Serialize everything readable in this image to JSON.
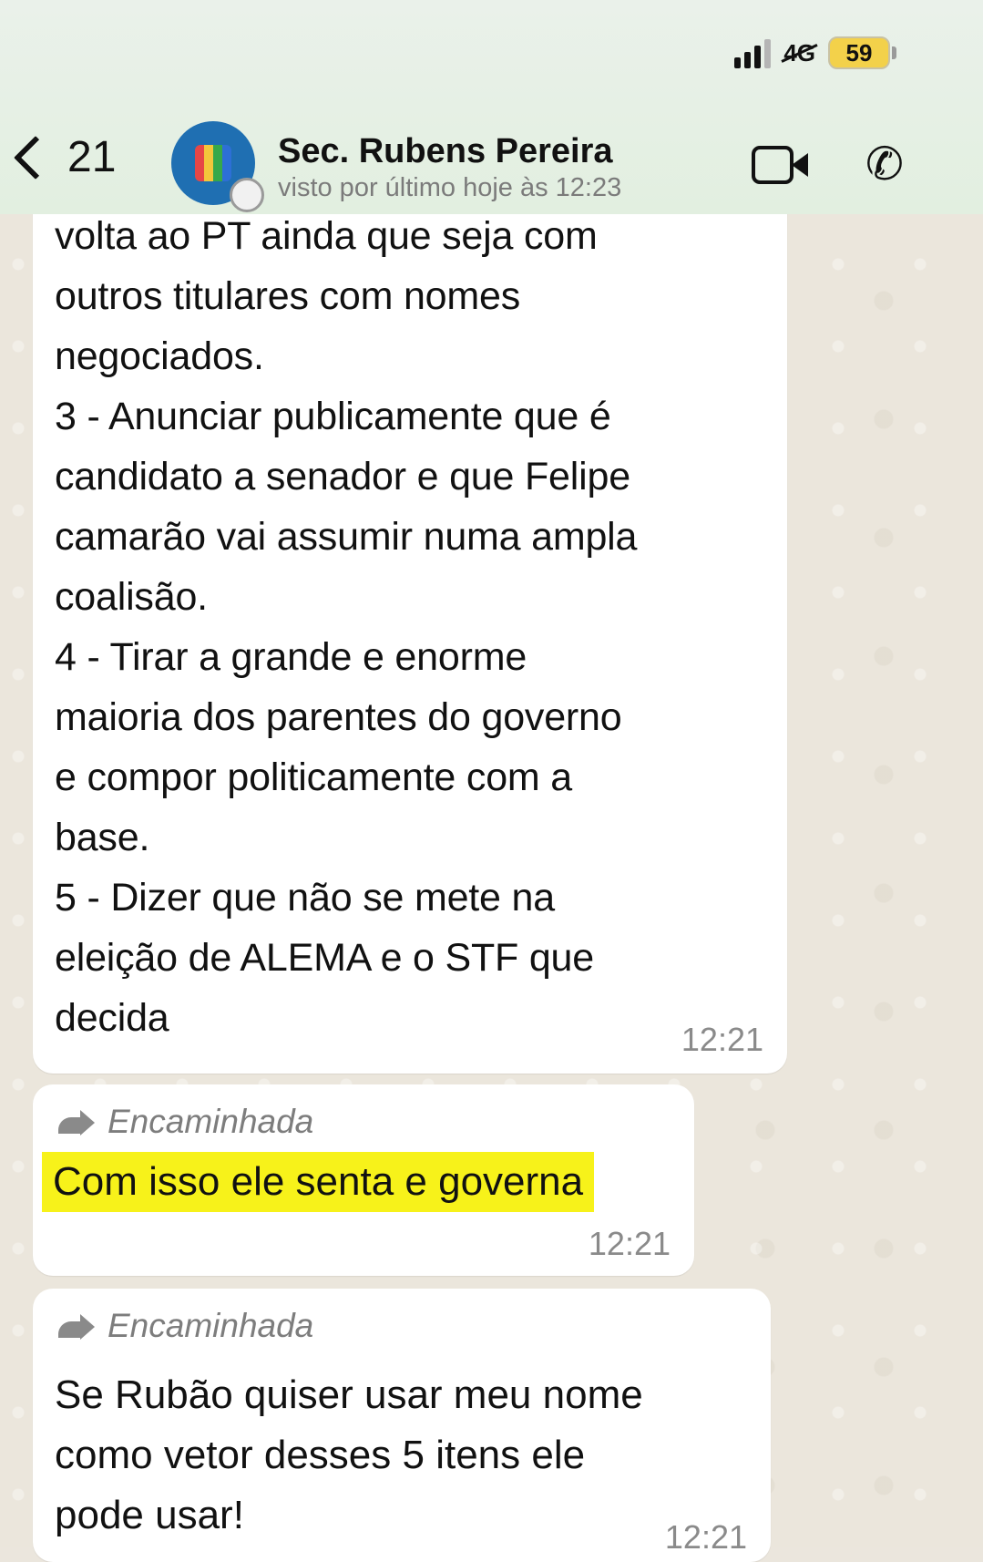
{
  "status_bar": {
    "battery": "59"
  },
  "header": {
    "back_count": "21",
    "contact_name": "Sec. Rubens Pereira",
    "last_seen": "visto por último hoje às 12:23"
  },
  "messages": [
    {
      "text": "volta ao PT ainda que seja com\noutros titulares com nomes\nnegociados.\n3 - Anunciar publicamente que é\ncandidato a senador e que Felipe\ncamarão vai assumir numa ampla\ncoalisão.\n4 - Tirar a grande e enorme\nmaioria dos parentes do governo\ne compor politicamente com a\nbase.\n5 - Dizer que não se mete na\neleição de ALEMA e o STF que\ndecida",
      "time": "12:21"
    },
    {
      "forwarded_label": "Encaminhada",
      "text": "Com isso ele senta e governa",
      "time": "12:21"
    },
    {
      "forwarded_label": "Encaminhada",
      "text": "Se Rubão quiser usar meu nome\ncomo vetor desses 5 itens ele\npode usar!",
      "time": "12:21"
    }
  ],
  "icons": [
    "back-chevron-icon",
    "signal-icon",
    "network-icon",
    "battery-icon",
    "video-call-icon",
    "phone-icon",
    "forward-icon"
  ],
  "colors": {
    "highlight": "#f7f21a",
    "header_bg": "#e4efe2",
    "chat_bg": "#ebe6dd"
  }
}
